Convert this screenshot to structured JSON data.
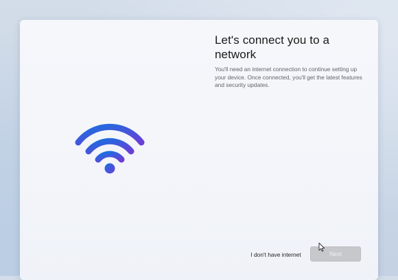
{
  "setup": {
    "title": "Let's connect you to a network",
    "description": "You'll need an internet connection to continue setting up your device. Once connected, you'll get the latest features and security updates.",
    "illustration_icon": "wifi-icon",
    "no_internet_label": "I don't have internet",
    "next_label": "Next",
    "next_enabled": false
  },
  "colors": {
    "wifi_gradient_start": "#1a6fe0",
    "wifi_gradient_end": "#6a3fd6",
    "next_button_disabled": "#c7c8cc"
  }
}
